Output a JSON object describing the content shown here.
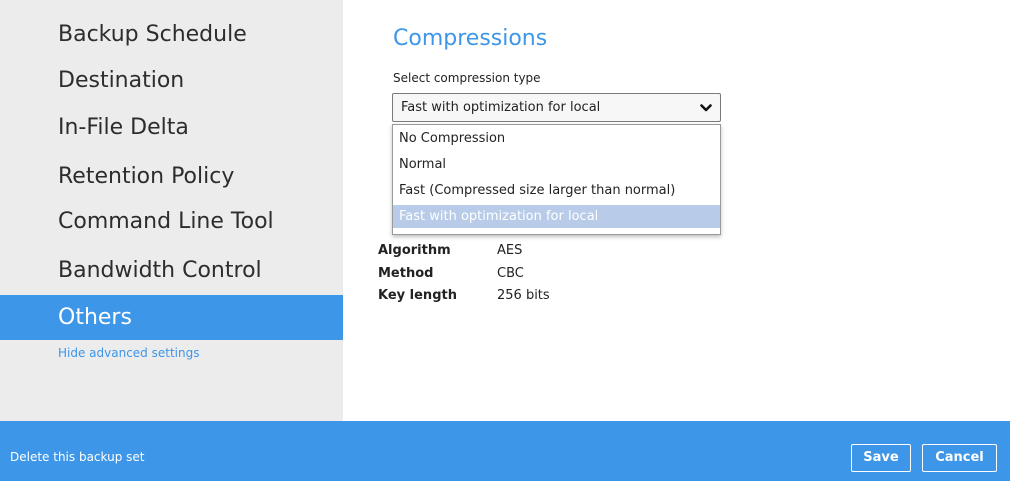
{
  "sidebar": {
    "items": [
      {
        "label": "Backup Schedule"
      },
      {
        "label": "Destination"
      },
      {
        "label": "In-File Delta"
      },
      {
        "label": "Retention Policy"
      },
      {
        "label": "Command Line Tool"
      },
      {
        "label": "Bandwidth Control"
      },
      {
        "label": "Others",
        "active": true
      }
    ],
    "advanced_link": "Hide advanced settings"
  },
  "main": {
    "title": "Compressions",
    "compression": {
      "label": "Select compression type",
      "selected": "Fast with optimization for local",
      "options": [
        "No Compression",
        "Normal",
        "Fast (Compressed size larger than normal)",
        "Fast with optimization for local"
      ]
    },
    "encryption": {
      "algorithm_label": "Algorithm",
      "algorithm_value": "AES",
      "method_label": "Method",
      "method_value": "CBC",
      "key_length_label": "Key length",
      "key_length_value": "256 bits"
    }
  },
  "footer": {
    "delete_label": "Delete this backup set",
    "save_label": "Save",
    "cancel_label": "Cancel"
  },
  "colors": {
    "accent": "#3d96e8",
    "sidebar_bg": "#ececec",
    "selected_option": "#b8cbe8"
  },
  "icons": {
    "dropdown": "chevron-down-icon"
  }
}
